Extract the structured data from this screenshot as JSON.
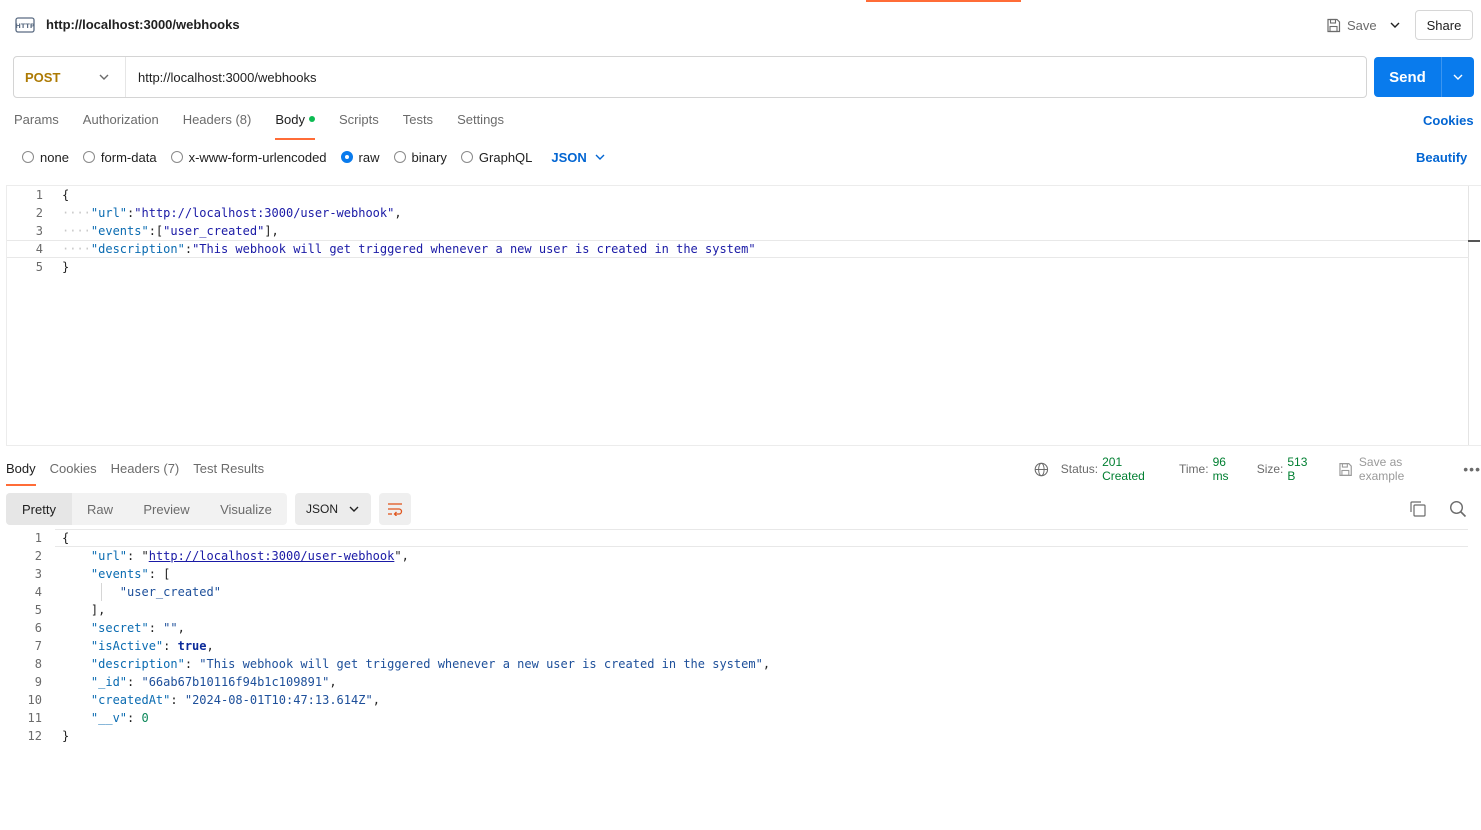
{
  "header": {
    "title": "http://localhost:3000/webhooks",
    "save_label": "Save",
    "share_label": "Share"
  },
  "request": {
    "method": "POST",
    "url": "http://localhost:3000/webhooks",
    "send_label": "Send",
    "tabs": [
      {
        "label": "Params"
      },
      {
        "label": "Authorization"
      },
      {
        "label": "Headers",
        "count": "(8)"
      },
      {
        "label": "Body"
      },
      {
        "label": "Scripts"
      },
      {
        "label": "Tests"
      },
      {
        "label": "Settings"
      }
    ],
    "cookies_label": "Cookies",
    "body_types": [
      "none",
      "form-data",
      "x-www-form-urlencoded",
      "raw",
      "binary",
      "GraphQL"
    ],
    "body_type_selected": "raw",
    "body_format": "JSON",
    "beautify_label": "Beautify",
    "body_lines": [
      "1",
      "2",
      "3",
      "4",
      "5"
    ],
    "body_code": {
      "l1": "{",
      "l2_key": "\"url\"",
      "l2_val": "\"http://localhost:3000/user-webhook\"",
      "l3_key": "\"events\"",
      "l3_val": "\"user_created\"",
      "l4_key": "\"description\"",
      "l4_val": "\"This webhook will get triggered whenever a new user is created in the system\"",
      "l5": "}"
    }
  },
  "response": {
    "tabs": [
      {
        "label": "Body"
      },
      {
        "label": "Cookies"
      },
      {
        "label": "Headers",
        "count": "(7)"
      },
      {
        "label": "Test Results"
      }
    ],
    "status_label": "Status:",
    "status_value": "201 Created",
    "time_label": "Time:",
    "time_value": "96 ms",
    "size_label": "Size:",
    "size_value": "513 B",
    "save_example_label": "Save as example",
    "views": [
      "Pretty",
      "Raw",
      "Preview",
      "Visualize"
    ],
    "format": "JSON",
    "lines": [
      "1",
      "2",
      "3",
      "4",
      "5",
      "6",
      "7",
      "8",
      "9",
      "10",
      "11",
      "12"
    ],
    "code": {
      "url_key": "\"url\"",
      "url_val": "http://localhost:3000/user-webhook",
      "events_key": "\"events\"",
      "events_item": "\"user_created\"",
      "secret_key": "\"secret\"",
      "secret_val": "\"\"",
      "isActive_key": "\"isActive\"",
      "isActive_val": "true",
      "description_key": "\"description\"",
      "description_val": "\"This webhook will get triggered whenever a new user is created in the system\"",
      "id_key": "\"_id\"",
      "id_val": "\"66ab67b10116f94b1c109891\"",
      "createdAt_key": "\"createdAt\"",
      "createdAt_val": "\"2024-08-01T10:47:13.614Z\"",
      "v_key": "\"__v\"",
      "v_val": "0"
    }
  },
  "colors": {
    "accent": "#ff6c37",
    "primary": "#097bed",
    "link": "#0265d2",
    "status_ok": "#007f31",
    "method_post": "#ad7a03"
  },
  "icons": [
    "http-request-icon",
    "save-icon",
    "chevron-down-icon",
    "globe-icon",
    "copy-icon",
    "search-icon",
    "wrap-lines-icon",
    "more-icon"
  ]
}
